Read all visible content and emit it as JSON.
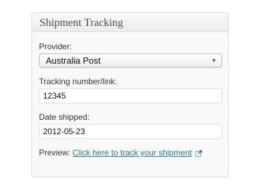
{
  "metabox": {
    "title": "Shipment Tracking"
  },
  "form": {
    "provider": {
      "label": "Provider:",
      "selected": "Australia Post"
    },
    "tracking": {
      "label": "Tracking number/link:",
      "value": "12345"
    },
    "date": {
      "label": "Date shipped:",
      "value": "2012-05-23"
    },
    "preview": {
      "label": "Preview:",
      "link_text": "Click here to track your shipment",
      "icon": "external-link-icon"
    }
  },
  "colors": {
    "link": "#21759b",
    "border": "#dfdfdf",
    "panel_bg": "#f9f9f9"
  }
}
